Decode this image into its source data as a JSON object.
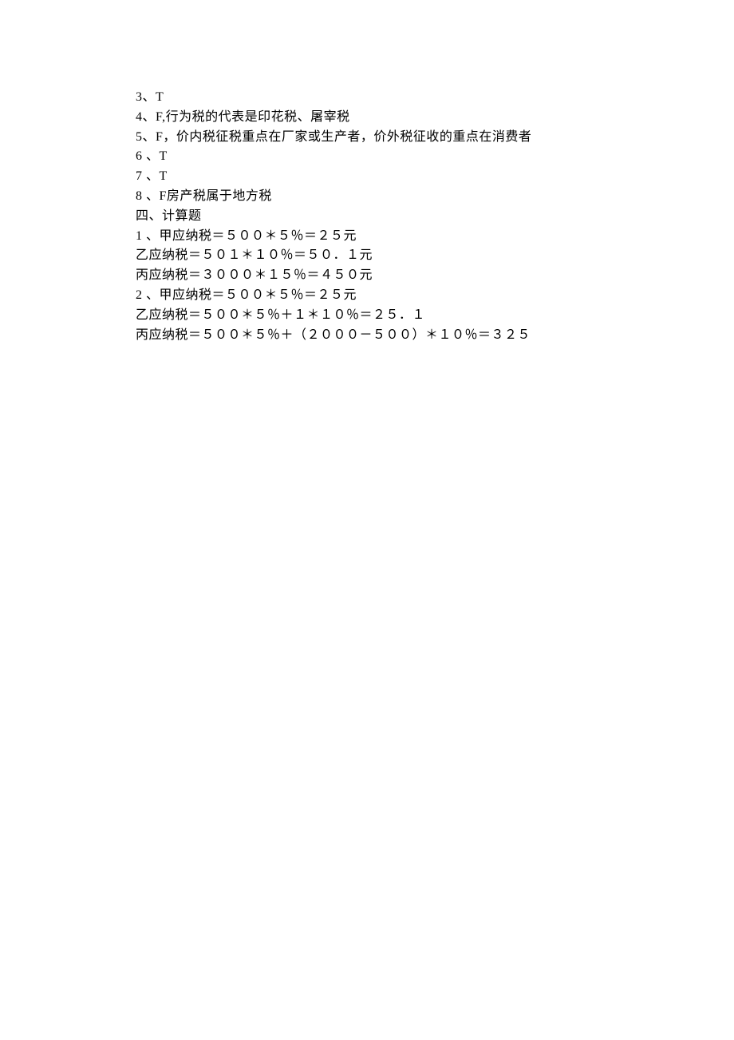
{
  "lines": [
    "3、T",
    "4、F,行为税的代表是印花税、屠宰税",
    "5、F，价内税征税重点在厂家或生产者，价外税征收的重点在消费者",
    "6 、T",
    " 7 、T",
    " 8 、F房产税属于地方税",
    "四、计算题",
    " 1 、甲应纳税＝５００＊５％＝２５元",
    "乙应纳税＝５０１＊１０％＝５０．１元",
    "丙应纳税＝３０００＊１５％＝４５０元",
    " 2 、甲应纳税＝５００＊５％＝２５元",
    "乙应纳税＝５００＊５％＋１＊１０％＝２５．１",
    "丙应纳税＝５００＊５％＋（２０００－５００）＊１０％＝３２５"
  ]
}
